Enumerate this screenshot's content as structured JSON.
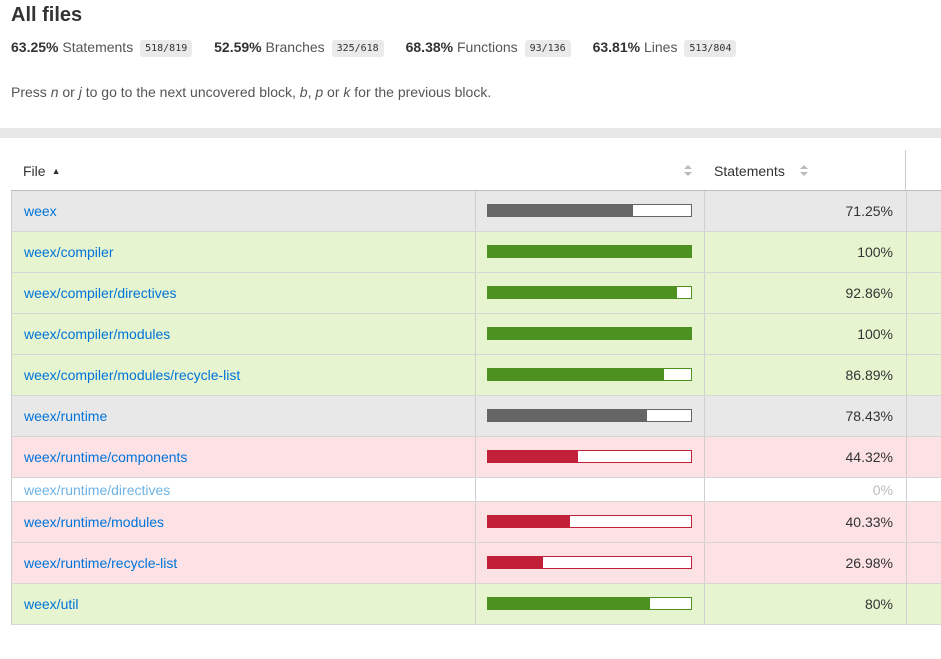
{
  "header": {
    "title": "All files",
    "metrics": [
      {
        "pct": "63.25%",
        "label": "Statements",
        "fraction": "518/819"
      },
      {
        "pct": "52.59%",
        "label": "Branches",
        "fraction": "325/618"
      },
      {
        "pct": "68.38%",
        "label": "Functions",
        "fraction": "93/136"
      },
      {
        "pct": "63.81%",
        "label": "Lines",
        "fraction": "513/804"
      }
    ],
    "hint": {
      "press": "Press ",
      "k1": "n",
      "or1": " or ",
      "k2": "j",
      "mid": " to go to the next uncovered block, ",
      "k3": "b",
      "comma": ", ",
      "k4": "p",
      "or2": " or ",
      "k5": "k",
      "end": " for the previous block."
    }
  },
  "table": {
    "columns": {
      "file": "File",
      "file_sort": "▲",
      "statements": "Statements"
    },
    "colors": {
      "high_bg": "#e6f5d0",
      "high_bar": "#4d9221",
      "medium_bg": "#e8e8e8",
      "medium_bar": "#666666",
      "low_bg": "#fce1e5",
      "low_bar": "#c21f39",
      "empty_bg": "#ffffff"
    },
    "rows": [
      {
        "file": "weex",
        "pct": "71.25%",
        "fill": 0.7125,
        "level": "medium"
      },
      {
        "file": "weex/compiler",
        "pct": "100%",
        "fill": 1.0,
        "level": "high"
      },
      {
        "file": "weex/compiler/directives",
        "pct": "92.86%",
        "fill": 0.9286,
        "level": "high"
      },
      {
        "file": "weex/compiler/modules",
        "pct": "100%",
        "fill": 1.0,
        "level": "high"
      },
      {
        "file": "weex/compiler/modules/recycle-list",
        "pct": "86.89%",
        "fill": 0.8689,
        "level": "high"
      },
      {
        "file": "weex/runtime",
        "pct": "78.43%",
        "fill": 0.7843,
        "level": "medium"
      },
      {
        "file": "weex/runtime/components",
        "pct": "44.32%",
        "fill": 0.4432,
        "level": "low"
      },
      {
        "file": "weex/runtime/directives",
        "pct": "0%",
        "fill": 0,
        "level": "empty"
      },
      {
        "file": "weex/runtime/modules",
        "pct": "40.33%",
        "fill": 0.4033,
        "level": "low"
      },
      {
        "file": "weex/runtime/recycle-list",
        "pct": "26.98%",
        "fill": 0.2698,
        "level": "low"
      },
      {
        "file": "weex/util",
        "pct": "80%",
        "fill": 0.8,
        "level": "high"
      }
    ]
  }
}
